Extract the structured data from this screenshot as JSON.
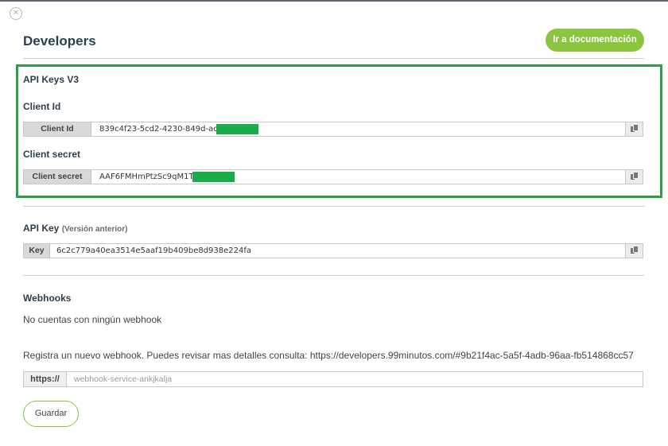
{
  "header": {
    "close_symbol": "✕",
    "title": "Developers",
    "doc_button_label": "Ir a documentación"
  },
  "api_keys_v3": {
    "section_title": "API Keys V3",
    "client_id": {
      "heading": "Client Id",
      "addon_label": "Client Id",
      "value": "839c4f23-5cd2-4230-849d-adf"
    },
    "client_secret": {
      "heading": "Client secret",
      "addon_label": "Client secret",
      "value": "AAF6FMHmPtzSc9qM1Ta"
    }
  },
  "api_key_legacy": {
    "heading": "API Key",
    "note": "(Versión anterior)",
    "addon_label": "Key",
    "value": "6c2c779a40ea3514e5aaf19b409be8d938e224fa"
  },
  "webhooks": {
    "heading": "Webhooks",
    "empty_message": "No cuentas con ningún webhook",
    "register_text": "Registra un nuevo webhook. Puedes revisar mas detalles consulta:  https://developers.99minutos.com/#9b21f4ac-5a5f-4adb-96aa-fb514868cc57",
    "url_prefix": "https://",
    "url_placeholder": "webhook-service-ankjkalja",
    "save_button_label": "Guardar"
  },
  "colors": {
    "accent_green": "#8bc53f",
    "highlight_border": "#2e9e4a",
    "redaction": "#1aac4a",
    "title": "#2a3f54"
  },
  "icons": {
    "close": "close-icon",
    "copy": "copy-icon"
  }
}
